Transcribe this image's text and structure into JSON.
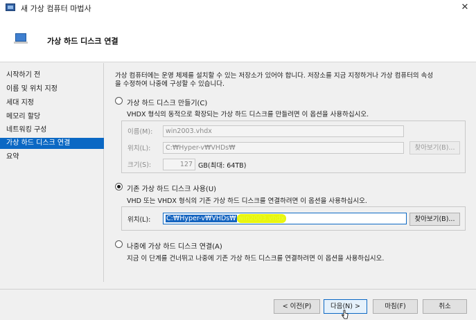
{
  "window": {
    "title": "새 가상 컴퓨터 마법사",
    "close_glyph": "✕"
  },
  "header": {
    "title": "가상 하드 디스크 연결"
  },
  "sidebar": {
    "items": [
      {
        "label": "시작하기 전"
      },
      {
        "label": "이름 및 위치 지정"
      },
      {
        "label": "세대 지정"
      },
      {
        "label": "메모리 할당"
      },
      {
        "label": "네트워킹 구성"
      },
      {
        "label": "가상 하드 디스크 연결"
      },
      {
        "label": "요약"
      }
    ],
    "active_index": 5
  },
  "main": {
    "intro_line1": "가상 컴퓨터에는 운영 체제를 설치할 수 있는 저장소가 있어야 합니다. 저장소를 지금 지정하거나 가상 컴퓨터의 속성",
    "intro_line2": "을 수정하여 나중에 구성할 수 있습니다.",
    "create_option": {
      "label": "가상 하드 디스크 만들기(C)",
      "description": "VHDX 형식의 동적으로 확장되는 가상 하드 디스크를 만들려면 이 옵션을 사용하십시오.",
      "name_label": "이름(M):",
      "name_value": "win2003.vhdx",
      "location_label": "위치(L):",
      "location_value": "C:₩Hyper-v₩VHDs₩",
      "browse_label": "찾아보기(B)...",
      "size_label": "크기(S):",
      "size_value": "127",
      "size_unit": "GB(최대: 64TB)"
    },
    "existing_option": {
      "label": "기존 가상 하드 디스크 사용(U)",
      "description": "VHD 또는 VHDX 형식의 기존 가상 하드 디스크를 연결하려면 이 옵션을 사용하십시오.",
      "location_label": "위치(L):",
      "location_value_path": "C:₩Hyper-v₩VHDs₩",
      "location_value_file": "win2003.vhdx",
      "browse_label": "찾아보기(B)..."
    },
    "later_option": {
      "label": "나중에 가상 하드 디스크 연결(A)",
      "description": "지금 이 단계를 건너뛰고 나중에 기존 가상 하드 디스크를 연결하려면 이 옵션을 사용하십시오."
    },
    "selected_option": "existing"
  },
  "footer": {
    "previous_label": "< 이전(P)",
    "next_label": "다음(N) >",
    "finish_label": "마침(F)",
    "cancel_label": "취소"
  },
  "colors": {
    "accent": "#0b68c4",
    "highlight": "#e9f50f"
  }
}
